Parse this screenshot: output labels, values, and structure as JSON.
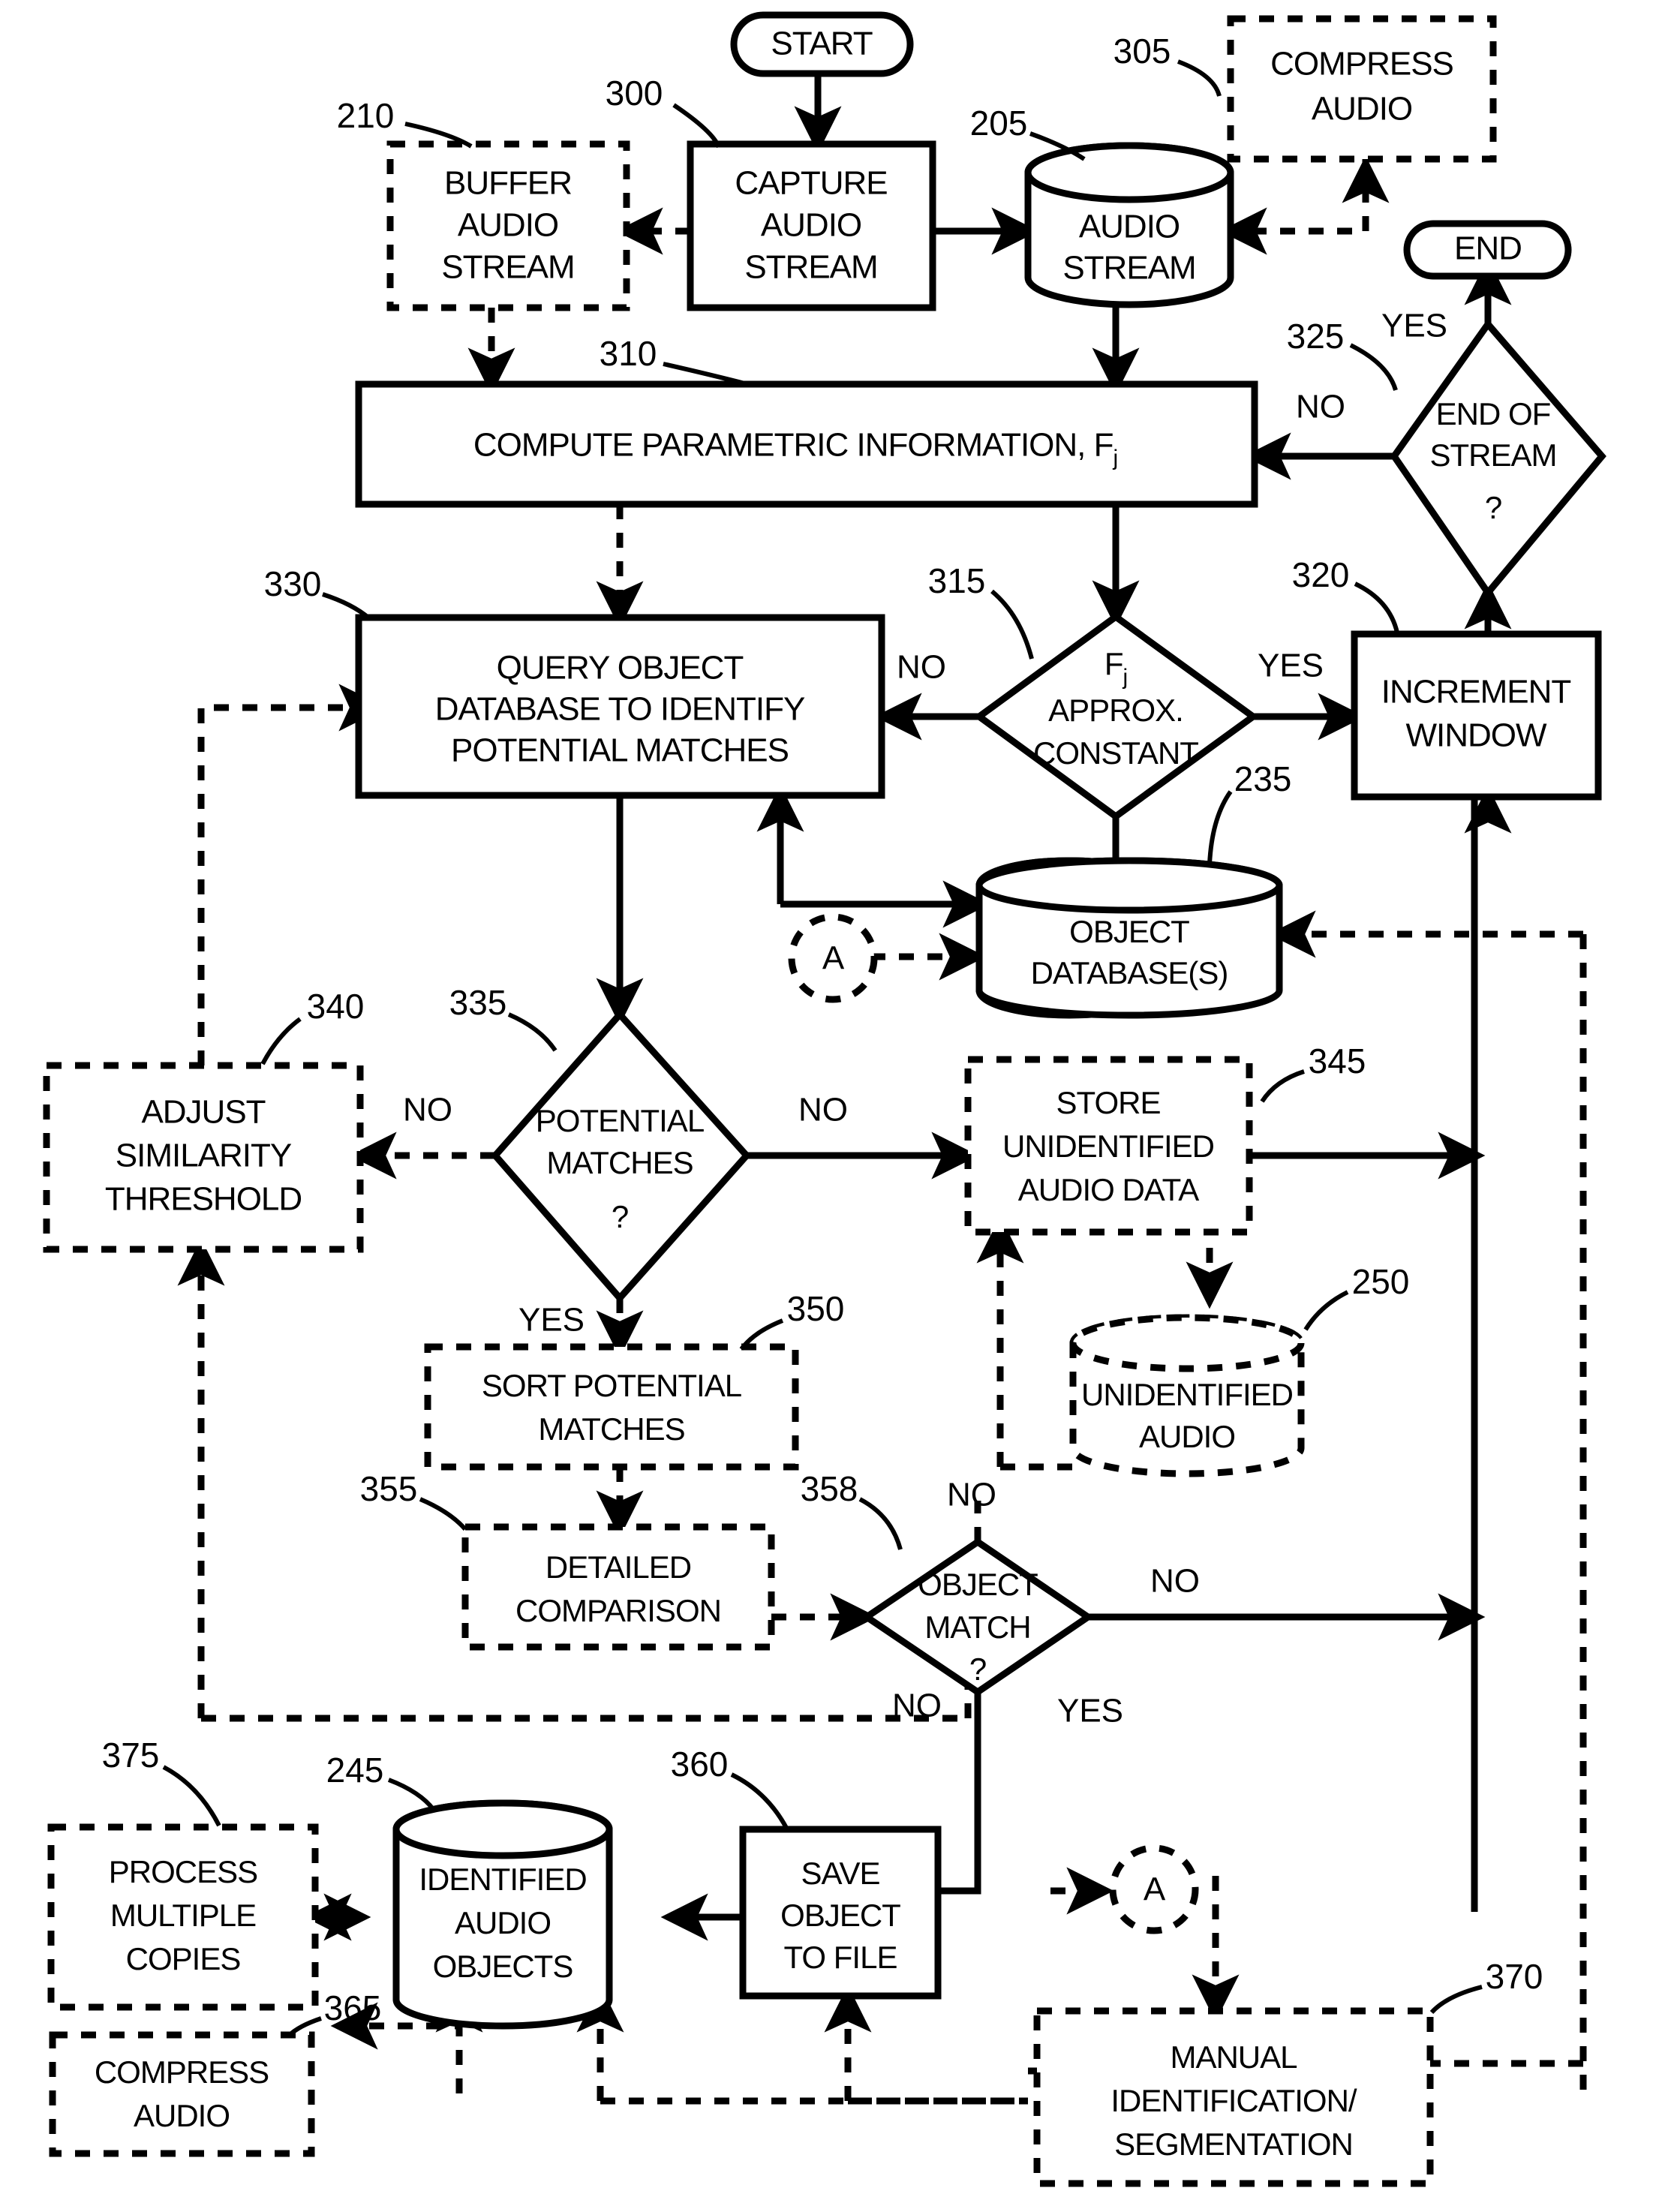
{
  "figure": {
    "type": "patent-flowchart",
    "title": "Audio object identification flowchart",
    "colors": {
      "stroke": "#000000",
      "fill": "#ffffff"
    }
  },
  "nodes": {
    "start": {
      "ref": "",
      "label": "START",
      "shape": "terminator",
      "line": "solid"
    },
    "capture": {
      "ref": "300",
      "label": "CAPTURE\nAUDIO\nSTREAM",
      "shape": "process",
      "line": "solid"
    },
    "buffer": {
      "ref": "210",
      "label": "BUFFER\nAUDIO\nSTREAM",
      "shape": "process",
      "line": "dashed"
    },
    "audiostream": {
      "ref": "205",
      "label": "AUDIO\nSTREAM",
      "shape": "cylinder",
      "line": "solid"
    },
    "compress_top": {
      "ref": "305",
      "label": "COMPRESS\nAUDIO",
      "shape": "process",
      "line": "dashed"
    },
    "end": {
      "ref": "",
      "label": "END",
      "shape": "terminator",
      "line": "solid"
    },
    "endofstream": {
      "ref": "325",
      "label": "END OF\nSTREAM\n?",
      "shape": "decision",
      "line": "solid"
    },
    "compute": {
      "ref": "310",
      "label": "COMPUTE PARAMETRIC INFORMATION, F",
      "label_sub": "j",
      "shape": "process",
      "line": "solid"
    },
    "query": {
      "ref": "330",
      "label": "QUERY OBJECT\nDATABASE TO IDENTIFY\nPOTENTIAL MATCHES",
      "shape": "process",
      "line": "solid"
    },
    "approx": {
      "ref": "315",
      "label": "F\nAPPROX.\nCONSTANT",
      "label_sub": "j",
      "shape": "decision",
      "line": "solid"
    },
    "increment": {
      "ref": "320",
      "label": "INCREMENT\nWINDOW",
      "shape": "process",
      "line": "solid"
    },
    "objectdb": {
      "ref": "235",
      "label": "OBJECT\nDATABASE(S)",
      "shape": "cylinder",
      "line": "solid"
    },
    "connA_top": {
      "ref": "",
      "label": "A",
      "shape": "connector",
      "line": "dashed"
    },
    "adjust": {
      "ref": "340",
      "label": "ADJUST\nSIMILARITY\nTHRESHOLD",
      "shape": "process",
      "line": "dashed"
    },
    "potential": {
      "ref": "335",
      "label": "POTENTIAL\nMATCHES\n?",
      "shape": "decision",
      "line": "solid"
    },
    "store": {
      "ref": "345",
      "label": "STORE\nUNIDENTIFIED\nAUDIO DATA",
      "shape": "process",
      "line": "dashed"
    },
    "unidentified": {
      "ref": "250",
      "label": "UNIDENTIFIED\nAUDIO",
      "shape": "cylinder",
      "line": "dashed"
    },
    "sort": {
      "ref": "350",
      "label": "SORT POTENTIAL\nMATCHES",
      "shape": "process",
      "line": "dashed"
    },
    "detailed": {
      "ref": "355",
      "label": "DETAILED\nCOMPARISON",
      "shape": "process",
      "line": "dashed"
    },
    "objectmatch": {
      "ref": "358",
      "label": "OBJECT\nMATCH\n?",
      "shape": "decision",
      "line": "solid"
    },
    "processmult": {
      "ref": "375",
      "label": "PROCESS\nMULTIPLE\nCOPIES",
      "shape": "process",
      "line": "dashed"
    },
    "identified": {
      "ref": "245",
      "label": "IDENTIFIED\nAUDIO\nOBJECTS",
      "shape": "cylinder",
      "line": "solid"
    },
    "save": {
      "ref": "360",
      "label": "SAVE\nOBJECT\nTO FILE",
      "shape": "process",
      "line": "solid"
    },
    "connA_bot": {
      "ref": "",
      "label": "A",
      "shape": "connector",
      "line": "dashed"
    },
    "compress_bot": {
      "ref": "365",
      "label": "COMPRESS\nAUDIO",
      "shape": "process",
      "line": "dashed"
    },
    "manual": {
      "ref": "370",
      "label": "MANUAL\nIDENTIFICATION/\nSEGMENTATION",
      "shape": "process",
      "line": "dashed"
    }
  },
  "edge_labels": {
    "eos_yes": "YES",
    "eos_no": "NO",
    "approx_no": "NO",
    "approx_yes": "YES",
    "potential_no_left": "NO",
    "potential_no_right": "NO",
    "potential_yes": "YES",
    "match_no_top": "NO",
    "match_no_right": "NO",
    "match_no_bottom": "NO",
    "match_yes": "YES"
  },
  "ref_numbers": {
    "r210": "210",
    "r300": "300",
    "r205": "205",
    "r305": "305",
    "r310": "310",
    "r325": "325",
    "r330": "330",
    "r315": "315",
    "r320": "320",
    "r235": "235",
    "r340": "340",
    "r335": "335",
    "r345": "345",
    "r250": "250",
    "r350": "350",
    "r355": "355",
    "r358": "358",
    "r375": "375",
    "r245": "245",
    "r360": "360",
    "r365": "365",
    "r370": "370"
  }
}
